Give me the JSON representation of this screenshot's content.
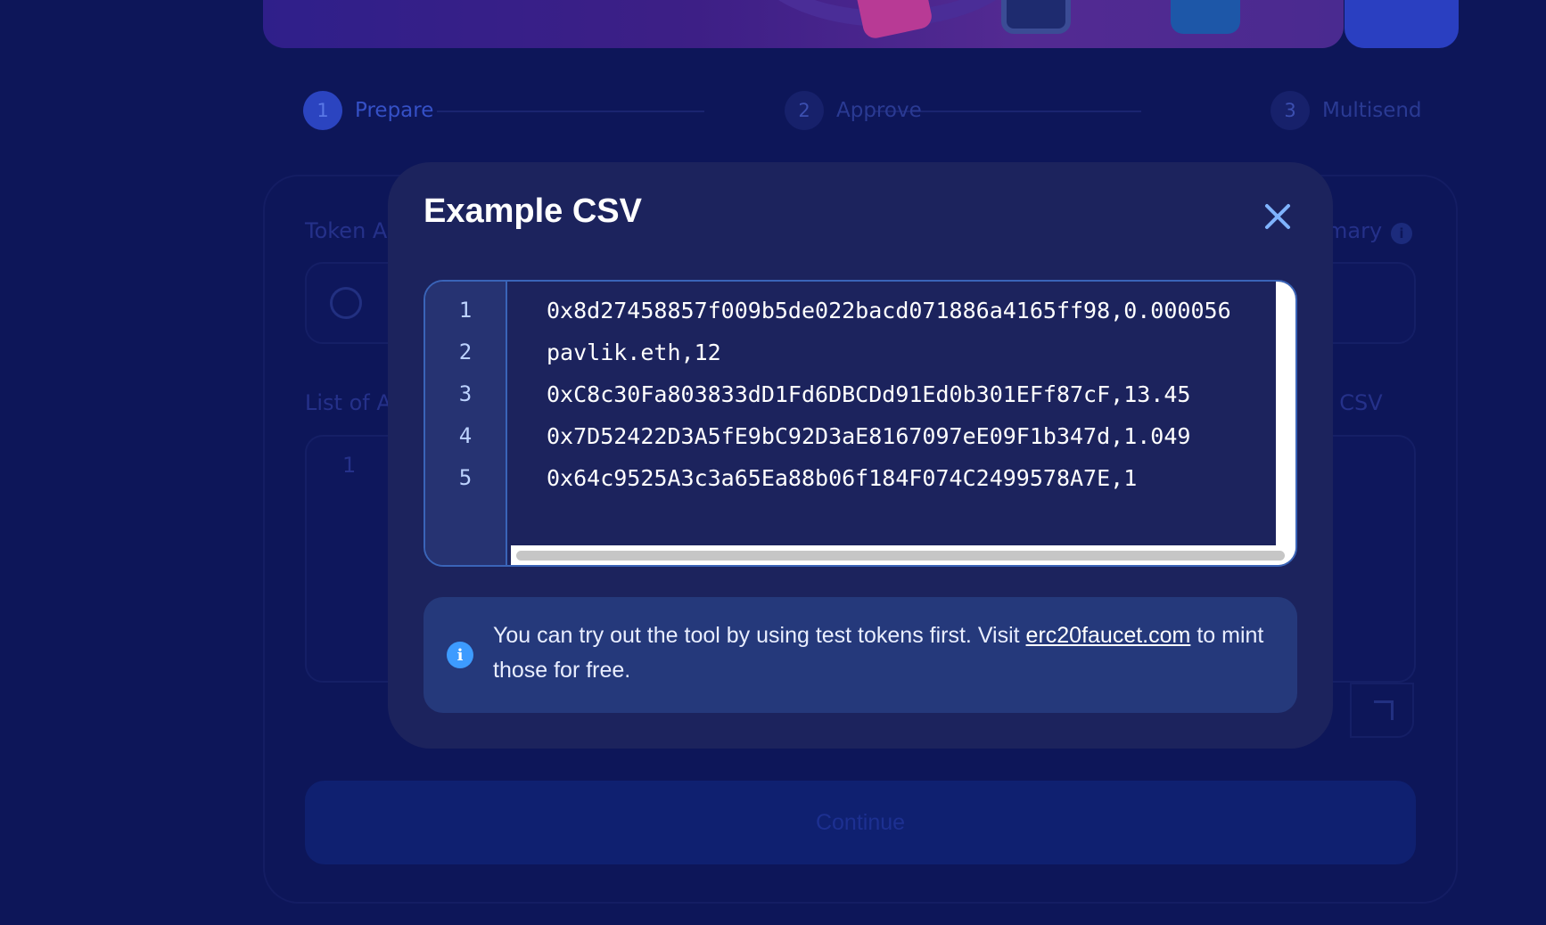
{
  "steps": [
    {
      "number": "1",
      "label": "Prepare",
      "active": true
    },
    {
      "number": "2",
      "label": "Approve",
      "active": false
    },
    {
      "number": "3",
      "label": "Multisend",
      "active": false
    }
  ],
  "background_form": {
    "token_label": "Token A",
    "summary_label": "mary",
    "list_label": "List of A",
    "example_csv_link": "ple CSV",
    "editor_first_line": "1",
    "info_glyph": "i",
    "continue_label": "Continue"
  },
  "modal": {
    "title": "Example CSV",
    "editor": {
      "line_numbers": [
        "1",
        "2",
        "3",
        "4",
        "5"
      ],
      "lines": [
        "0x8d27458857f009b5de022bacd071886a4165ff98,0.000056",
        "pavlik.eth,12",
        "0xC8c30Fa803833dD1Fd6DBCDd91Ed0b301EFf87cF,13.45",
        "0x7D52422D3A5fE9bC92D3aE8167097eE09F1b347d,1.049",
        "0x64c9525A3c3a65Ea88b06f184F074C2499578A7E,1"
      ]
    },
    "notice": {
      "icon": "info-icon",
      "icon_glyph": "i",
      "text_before": "You can try out the tool by using test tokens first. Visit ",
      "link_text": "erc20faucet.com",
      "text_after": " to mint those for free."
    }
  },
  "colors": {
    "page_bg": "#0d1659",
    "modal_bg": "#1c235d",
    "accent": "#7fb3ff",
    "notice_bg": "#25397b",
    "info_icon": "#3d9bff"
  }
}
